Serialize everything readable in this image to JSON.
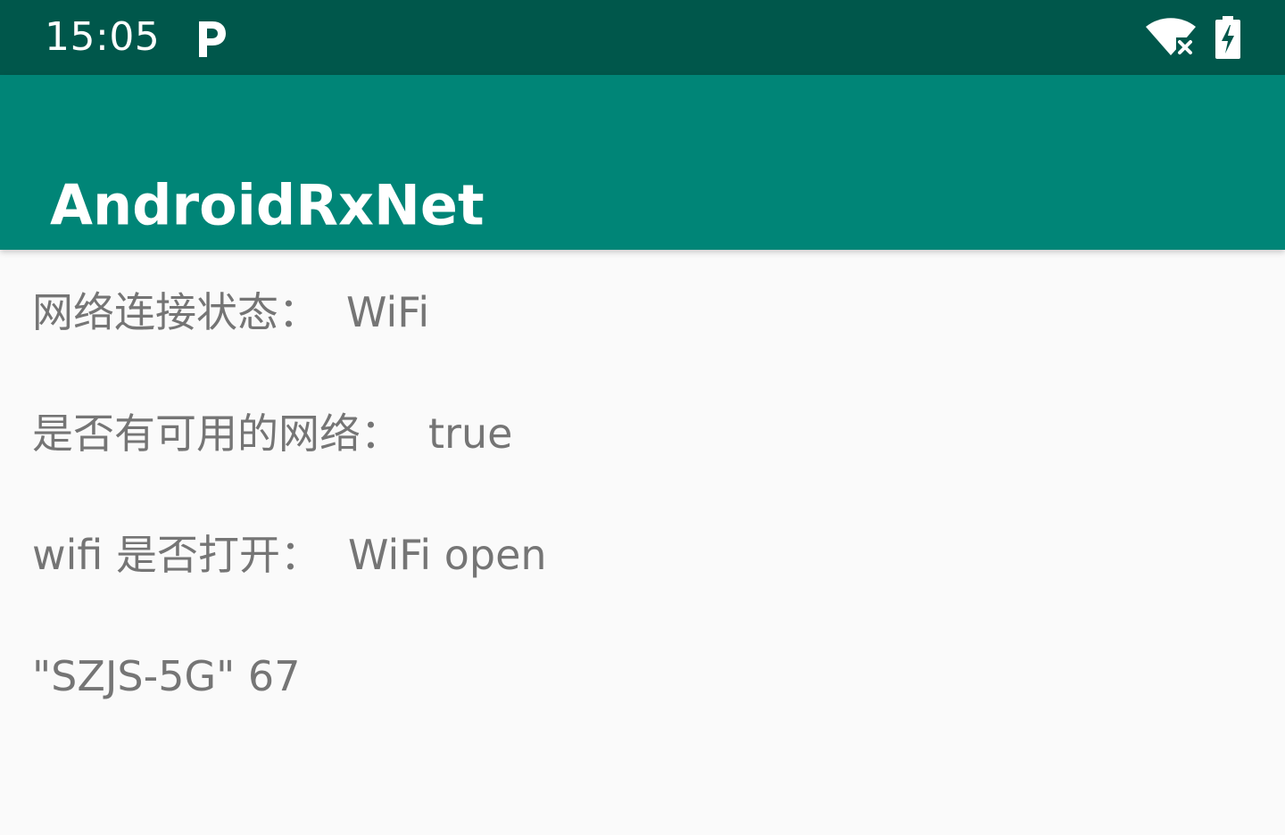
{
  "status_bar": {
    "time": "15:05",
    "notification_icon": "parking-icon",
    "wifi_icon": "wifi-off-icon",
    "battery_icon": "battery-charging-icon"
  },
  "app_bar": {
    "title": "AndroidRxNet"
  },
  "content": {
    "lines": [
      {
        "label": "网络连接状态：",
        "value": "WiFi"
      },
      {
        "label": "是否有可用的网络：",
        "value": "true"
      },
      {
        "label": "wifi 是否打开：",
        "value": "WiFi open"
      },
      {
        "label": "\"SZJS-5G\" 67"
      }
    ]
  },
  "colors": {
    "status_bar": "#00574b",
    "app_bar": "#008577",
    "background": "#fafafa",
    "text": "#757575"
  }
}
